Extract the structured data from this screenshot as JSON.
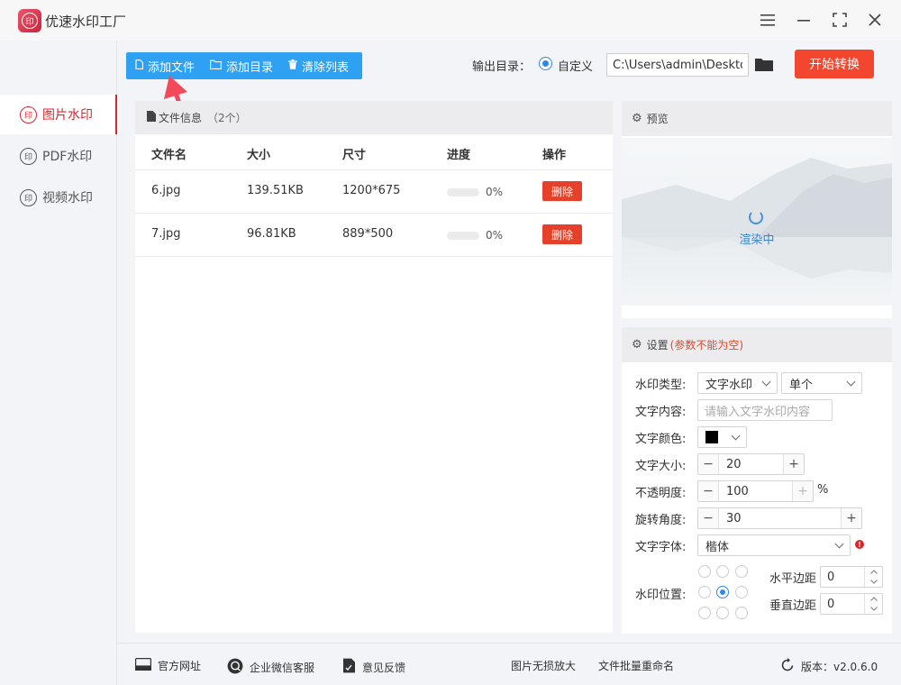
{
  "app": {
    "title": "优速水印工厂",
    "logo_text": "印"
  },
  "sidebar": {
    "items": [
      {
        "label": "图片水印",
        "icon_text": "印"
      },
      {
        "label": "PDF水印",
        "icon_text": "印"
      },
      {
        "label": "视频水印",
        "icon_text": "印"
      }
    ]
  },
  "toolbar": {
    "add_file": "添加文件",
    "add_dir": "添加目录",
    "clear_list": "清除列表",
    "output_label": "输出目录：",
    "output_option": "自定义",
    "output_path": "C:\\Users\\admin\\Deskto",
    "start": "开始转换"
  },
  "files": {
    "header": "文件信息",
    "count": "（2个）",
    "columns": [
      "文件名",
      "大小",
      "尺寸",
      "进度",
      "操作"
    ],
    "rows": [
      {
        "name": "6.jpg",
        "size": "139.51KB",
        "dims": "1200*675",
        "progress": "0%",
        "action": "删除"
      },
      {
        "name": "7.jpg",
        "size": "96.81KB",
        "dims": "889*500",
        "progress": "0%",
        "action": "删除"
      }
    ]
  },
  "preview": {
    "title": "预览",
    "status": "渲染中"
  },
  "settings": {
    "title": "设置",
    "note": "(参数不能为空)",
    "type_label": "水印类型:",
    "type_value": "文字水印",
    "mode_value": "单个",
    "content_label": "文字内容:",
    "content_placeholder": "请输入文字水印内容",
    "color_label": "文字颜色:",
    "color_value": "#000000",
    "size_label": "文字大小:",
    "size_value": "20",
    "opacity_label": "不透明度:",
    "opacity_value": "100",
    "opacity_unit": "%",
    "rotate_label": "旋转角度:",
    "rotate_value": "30",
    "font_label": "文字字体:",
    "font_value": "楷体",
    "position_label": "水印位置:",
    "h_margin_label": "水平边距",
    "h_margin_value": "0",
    "v_margin_label": "垂直边距",
    "v_margin_value": "0"
  },
  "footer": {
    "website": "官方网址",
    "wechat": "企业微信客服",
    "feedback": "意见反馈",
    "enlarge": "图片无损放大",
    "rename": "文件批量重命名",
    "version": "版本：v2.0.6.0"
  },
  "colors": {
    "accent": "#2fa1f2",
    "primary_red": "#f2462e",
    "sidebar_active": "#d8262f"
  }
}
